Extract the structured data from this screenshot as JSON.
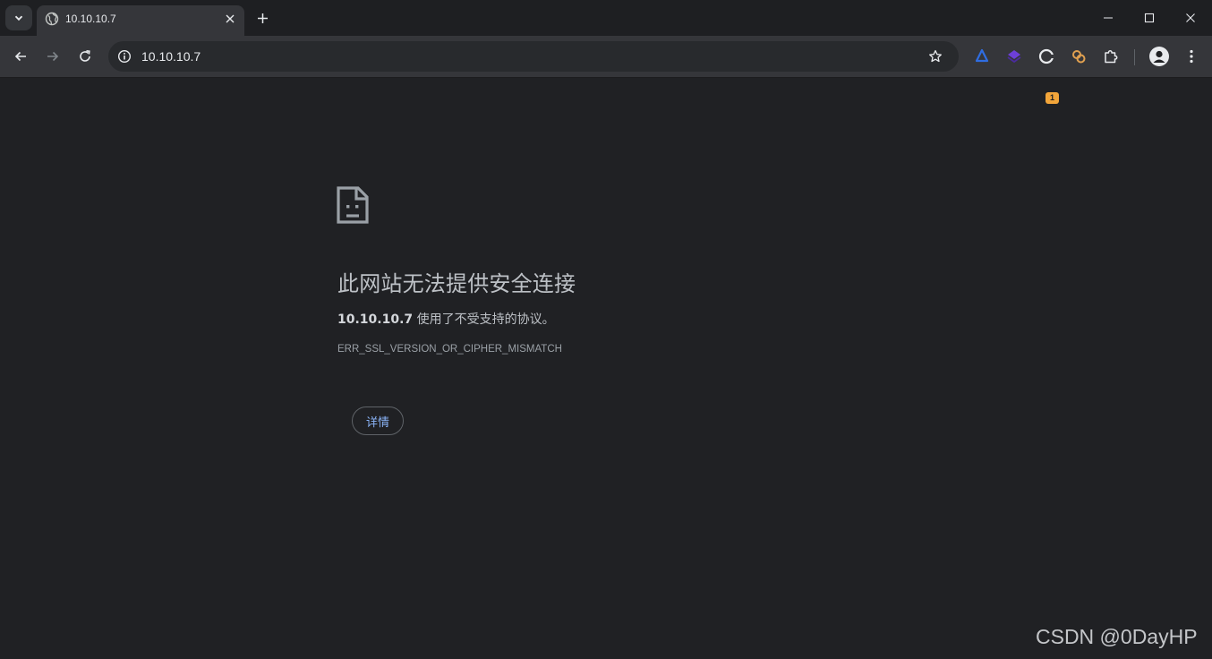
{
  "tab": {
    "title": "10.10.10.7"
  },
  "toolbar": {
    "url": "10.10.10.7",
    "extension_badge": "1"
  },
  "error": {
    "title": "此网站无法提供安全连接",
    "host": "10.10.10.7",
    "summary_rest": " 使用了不受支持的协议。",
    "code": "ERR_SSL_VERSION_OR_CIPHER_MISMATCH",
    "details_label": "详情"
  },
  "watermark": "CSDN @0DayHP",
  "icons": {
    "tab_search": "chevron-down-icon",
    "favicon": "globe-icon",
    "tab_close": "close-icon",
    "new_tab": "plus-icon",
    "back": "arrow-left-icon",
    "forward": "arrow-right-icon",
    "reload": "reload-icon",
    "site_info": "info-icon",
    "bookmark": "star-icon",
    "extensions": "puzzle-icon",
    "menu": "kebab-menu-icon",
    "error": "sad-page-icon"
  },
  "colors": {
    "page_background": "#202124",
    "toolbar": "#35363a",
    "link_blue": "#8ab4f8",
    "badge": "#f2a53a"
  }
}
